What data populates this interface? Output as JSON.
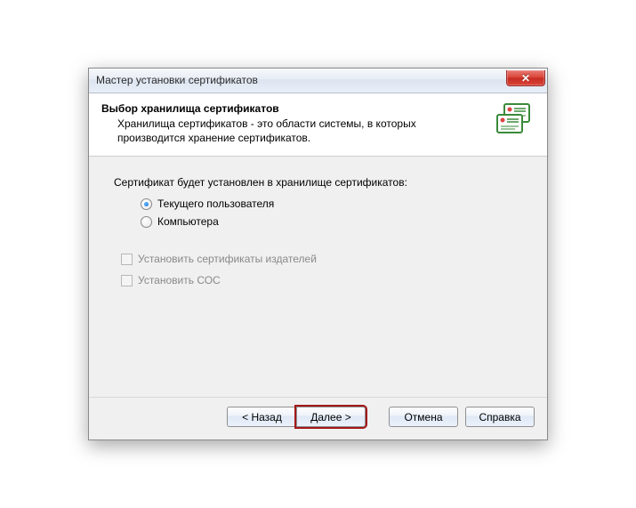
{
  "title": "Мастер установки сертификатов",
  "header": {
    "title": "Выбор хранилища сертификатов",
    "description": "Хранилища сертификатов - это области системы, в которых производится хранение сертификатов."
  },
  "body": {
    "prompt": "Сертификат будет установлен в хранилище сертификатов:",
    "radios": {
      "current_user": "Текущего пользователя",
      "computer": "Компьютера"
    },
    "checkboxes": {
      "publishers": "Установить сертификаты издателей",
      "coc": "Установить СОС"
    }
  },
  "footer": {
    "back": "< Назад",
    "next": "Далее >",
    "cancel": "Отмена",
    "help": "Справка"
  }
}
